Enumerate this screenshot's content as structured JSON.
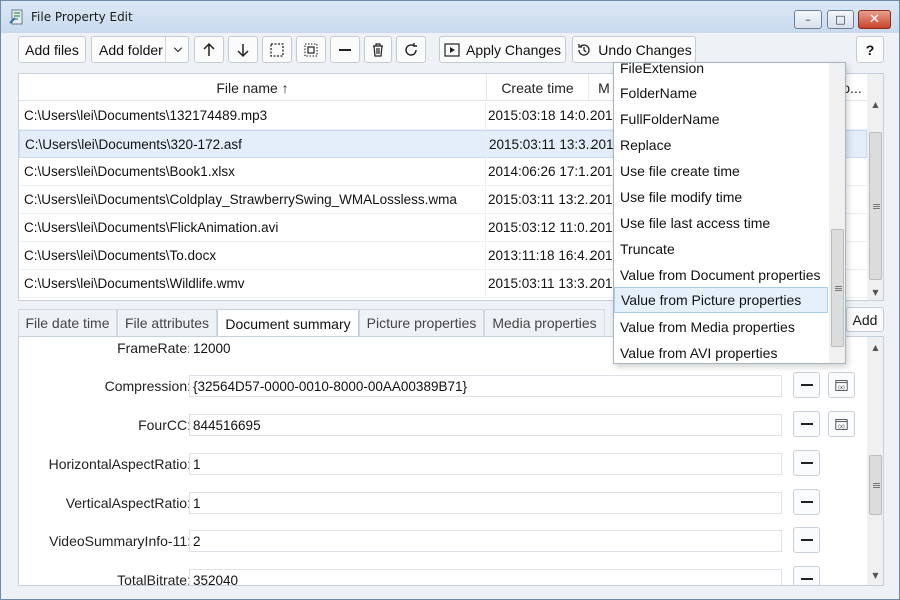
{
  "window": {
    "title": "File Property Edit",
    "controls": {
      "minimize": "–",
      "maximize": "□",
      "close": "✕"
    }
  },
  "toolbar": {
    "add_files": "Add files",
    "add_folder": "Add folder",
    "apply_changes": "Apply Changes",
    "undo_changes": "Undo Changes",
    "help": "?"
  },
  "file_list": {
    "columns": {
      "name": "File name ↑",
      "create_time": "Create time",
      "modify_time": "M",
      "other": "o..."
    },
    "rows": [
      {
        "name": "C:\\Users\\lei\\Documents\\132174489.mp3",
        "create_time": "2015:03:18 14:0...",
        "modify_time": "201"
      },
      {
        "name": "C:\\Users\\lei\\Documents\\320-172.asf",
        "create_time": "2015:03:11 13:3...",
        "modify_time": "201"
      },
      {
        "name": "C:\\Users\\lei\\Documents\\Book1.xlsx",
        "create_time": "2014:06:26 17:1...",
        "modify_time": "201"
      },
      {
        "name": "C:\\Users\\lei\\Documents\\Coldplay_StrawberrySwing_WMALossless.wma",
        "create_time": "2015:03:11 13:2...",
        "modify_time": "201"
      },
      {
        "name": "C:\\Users\\lei\\Documents\\FlickAnimation.avi",
        "create_time": "2015:03:12 11:0...",
        "modify_time": "201"
      },
      {
        "name": "C:\\Users\\lei\\Documents\\To.docx",
        "create_time": "2013:11:18 16:4...",
        "modify_time": "201"
      },
      {
        "name": "C:\\Users\\lei\\Documents\\Wildlife.wmv",
        "create_time": "2015:03:11 13:3...",
        "modify_time": "201"
      }
    ]
  },
  "tabs": [
    {
      "label": "File date time",
      "active": false
    },
    {
      "label": "File attributes",
      "active": false
    },
    {
      "label": "Document summary",
      "active": true
    },
    {
      "label": "Picture properties",
      "active": false
    },
    {
      "label": "Media properties",
      "active": false
    }
  ],
  "add_button": "Add",
  "properties": [
    {
      "label": "FrameRate:",
      "value": "12000"
    },
    {
      "label": "Compression:",
      "value": "{32564D57-0000-0010-8000-00AA00389B71}"
    },
    {
      "label": "FourCC:",
      "value": "844516695"
    },
    {
      "label": "HorizontalAspectRatio:",
      "value": "1"
    },
    {
      "label": "VerticalAspectRatio:",
      "value": "1"
    },
    {
      "label": "VideoSummaryInfo-11:",
      "value": "2"
    },
    {
      "label": "TotalBitrate:",
      "value": "352040"
    }
  ],
  "dropdown": {
    "items": [
      "FileExtension",
      "FolderName",
      "FullFolderName",
      "Replace",
      "Use file create time",
      "Use file modify time",
      "Use file last access time",
      "Truncate",
      "Value from Document properties",
      "Value from Picture properties",
      "Value from Media properties",
      "Value from AVI properties"
    ],
    "hovered_index": 9
  },
  "colors": {
    "accent_selection": "#e4eefa",
    "close_button": "#c7442b"
  }
}
